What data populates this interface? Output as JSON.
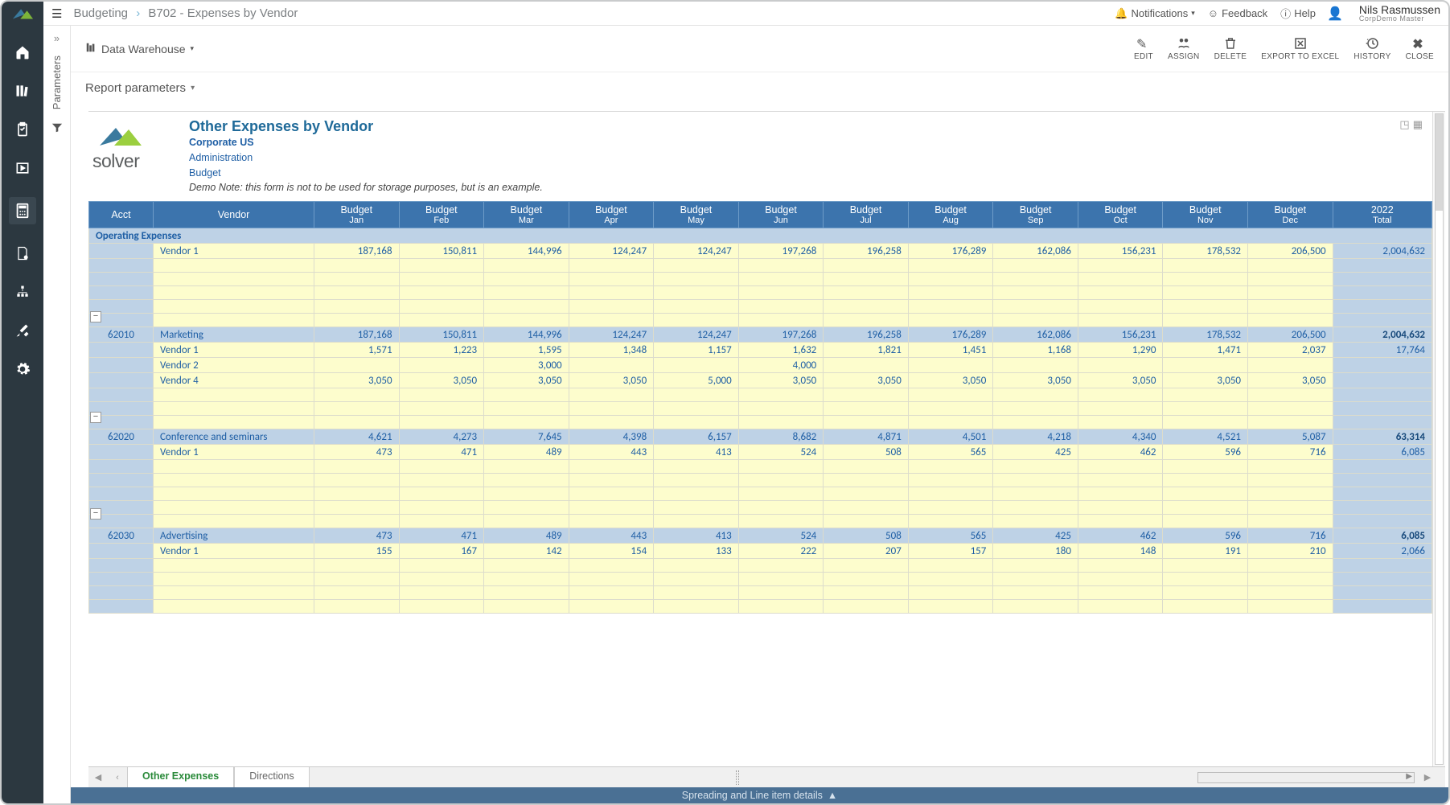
{
  "breadcrumb": {
    "root": "Budgeting",
    "page": "B702 - Expenses by Vendor"
  },
  "topbar": {
    "notifications": "Notifications",
    "feedback": "Feedback",
    "help": "Help",
    "user_name": "Nils Rasmussen",
    "user_sub": "CorpDemo Master"
  },
  "param_panel": {
    "label": "Parameters"
  },
  "toolbar": {
    "data_warehouse": "Data Warehouse",
    "edit": "EDIT",
    "assign": "ASSIGN",
    "delete": "DELETE",
    "export": "EXPORT TO EXCEL",
    "history": "HISTORY",
    "close": "CLOSE"
  },
  "report_params_label": "Report parameters",
  "report": {
    "title": "Other Expenses by Vendor",
    "entity": "Corporate US",
    "dept": "Administration",
    "scenario": "Budget",
    "note": "Demo Note: this form is not to be used for storage purposes, but is an example.",
    "logo_text": "solver"
  },
  "columns": {
    "acct": "Acct",
    "vendor": "Vendor",
    "months": [
      "Jan",
      "Feb",
      "Mar",
      "Apr",
      "May",
      "Jun",
      "Jul",
      "Aug",
      "Sep",
      "Oct",
      "Nov",
      "Dec"
    ],
    "budget_prefix": "Budget",
    "year": "2022",
    "total": "Total"
  },
  "section_header": "Operating Expenses",
  "rows": [
    {
      "type": "data",
      "vendor": "Vendor 1",
      "vals": [
        "187,168",
        "150,811",
        "144,996",
        "124,247",
        "124,247",
        "197,268",
        "196,258",
        "176,289",
        "162,086",
        "156,231",
        "178,532",
        "206,500"
      ],
      "total": "2,004,632"
    },
    {
      "type": "sum",
      "acct": "62010",
      "vendor": "Marketing",
      "vals": [
        "187,168",
        "150,811",
        "144,996",
        "124,247",
        "124,247",
        "197,268",
        "196,258",
        "176,289",
        "162,086",
        "156,231",
        "178,532",
        "206,500"
      ],
      "total": "2,004,632"
    },
    {
      "type": "data",
      "vendor": "Vendor 1",
      "vals": [
        "1,571",
        "1,223",
        "1,595",
        "1,348",
        "1,157",
        "1,632",
        "1,821",
        "1,451",
        "1,168",
        "1,290",
        "1,471",
        "2,037"
      ],
      "total": "17,764"
    },
    {
      "type": "data",
      "vendor": "Vendor 2",
      "vals": [
        "",
        "",
        "3,000",
        "",
        "",
        "4,000",
        "",
        "",
        "",
        "",
        "",
        ""
      ],
      "total": ""
    },
    {
      "type": "data",
      "vendor": "Vendor 4",
      "vals": [
        "3,050",
        "3,050",
        "3,050",
        "3,050",
        "5,000",
        "3,050",
        "3,050",
        "3,050",
        "3,050",
        "3,050",
        "3,050",
        "3,050"
      ],
      "total": ""
    },
    {
      "type": "sum",
      "acct": "62020",
      "vendor": "Conference and seminars",
      "vals": [
        "4,621",
        "4,273",
        "7,645",
        "4,398",
        "6,157",
        "8,682",
        "4,871",
        "4,501",
        "4,218",
        "4,340",
        "4,521",
        "5,087"
      ],
      "total": "63,314"
    },
    {
      "type": "data",
      "vendor": "Vendor 1",
      "vals": [
        "473",
        "471",
        "489",
        "443",
        "413",
        "524",
        "508",
        "565",
        "425",
        "462",
        "596",
        "716"
      ],
      "total": "6,085"
    },
    {
      "type": "sum",
      "acct": "62030",
      "vendor": "Advertising",
      "vals": [
        "473",
        "471",
        "489",
        "443",
        "413",
        "524",
        "508",
        "565",
        "425",
        "462",
        "596",
        "716"
      ],
      "total": "6,085"
    },
    {
      "type": "data",
      "vendor": "Vendor 1",
      "vals": [
        "155",
        "167",
        "142",
        "154",
        "133",
        "222",
        "207",
        "157",
        "180",
        "148",
        "191",
        "210"
      ],
      "total": "2,066"
    }
  ],
  "tabs": {
    "active": "Other Expenses",
    "second": "Directions"
  },
  "footer": {
    "label": "Spreading and Line item details"
  }
}
